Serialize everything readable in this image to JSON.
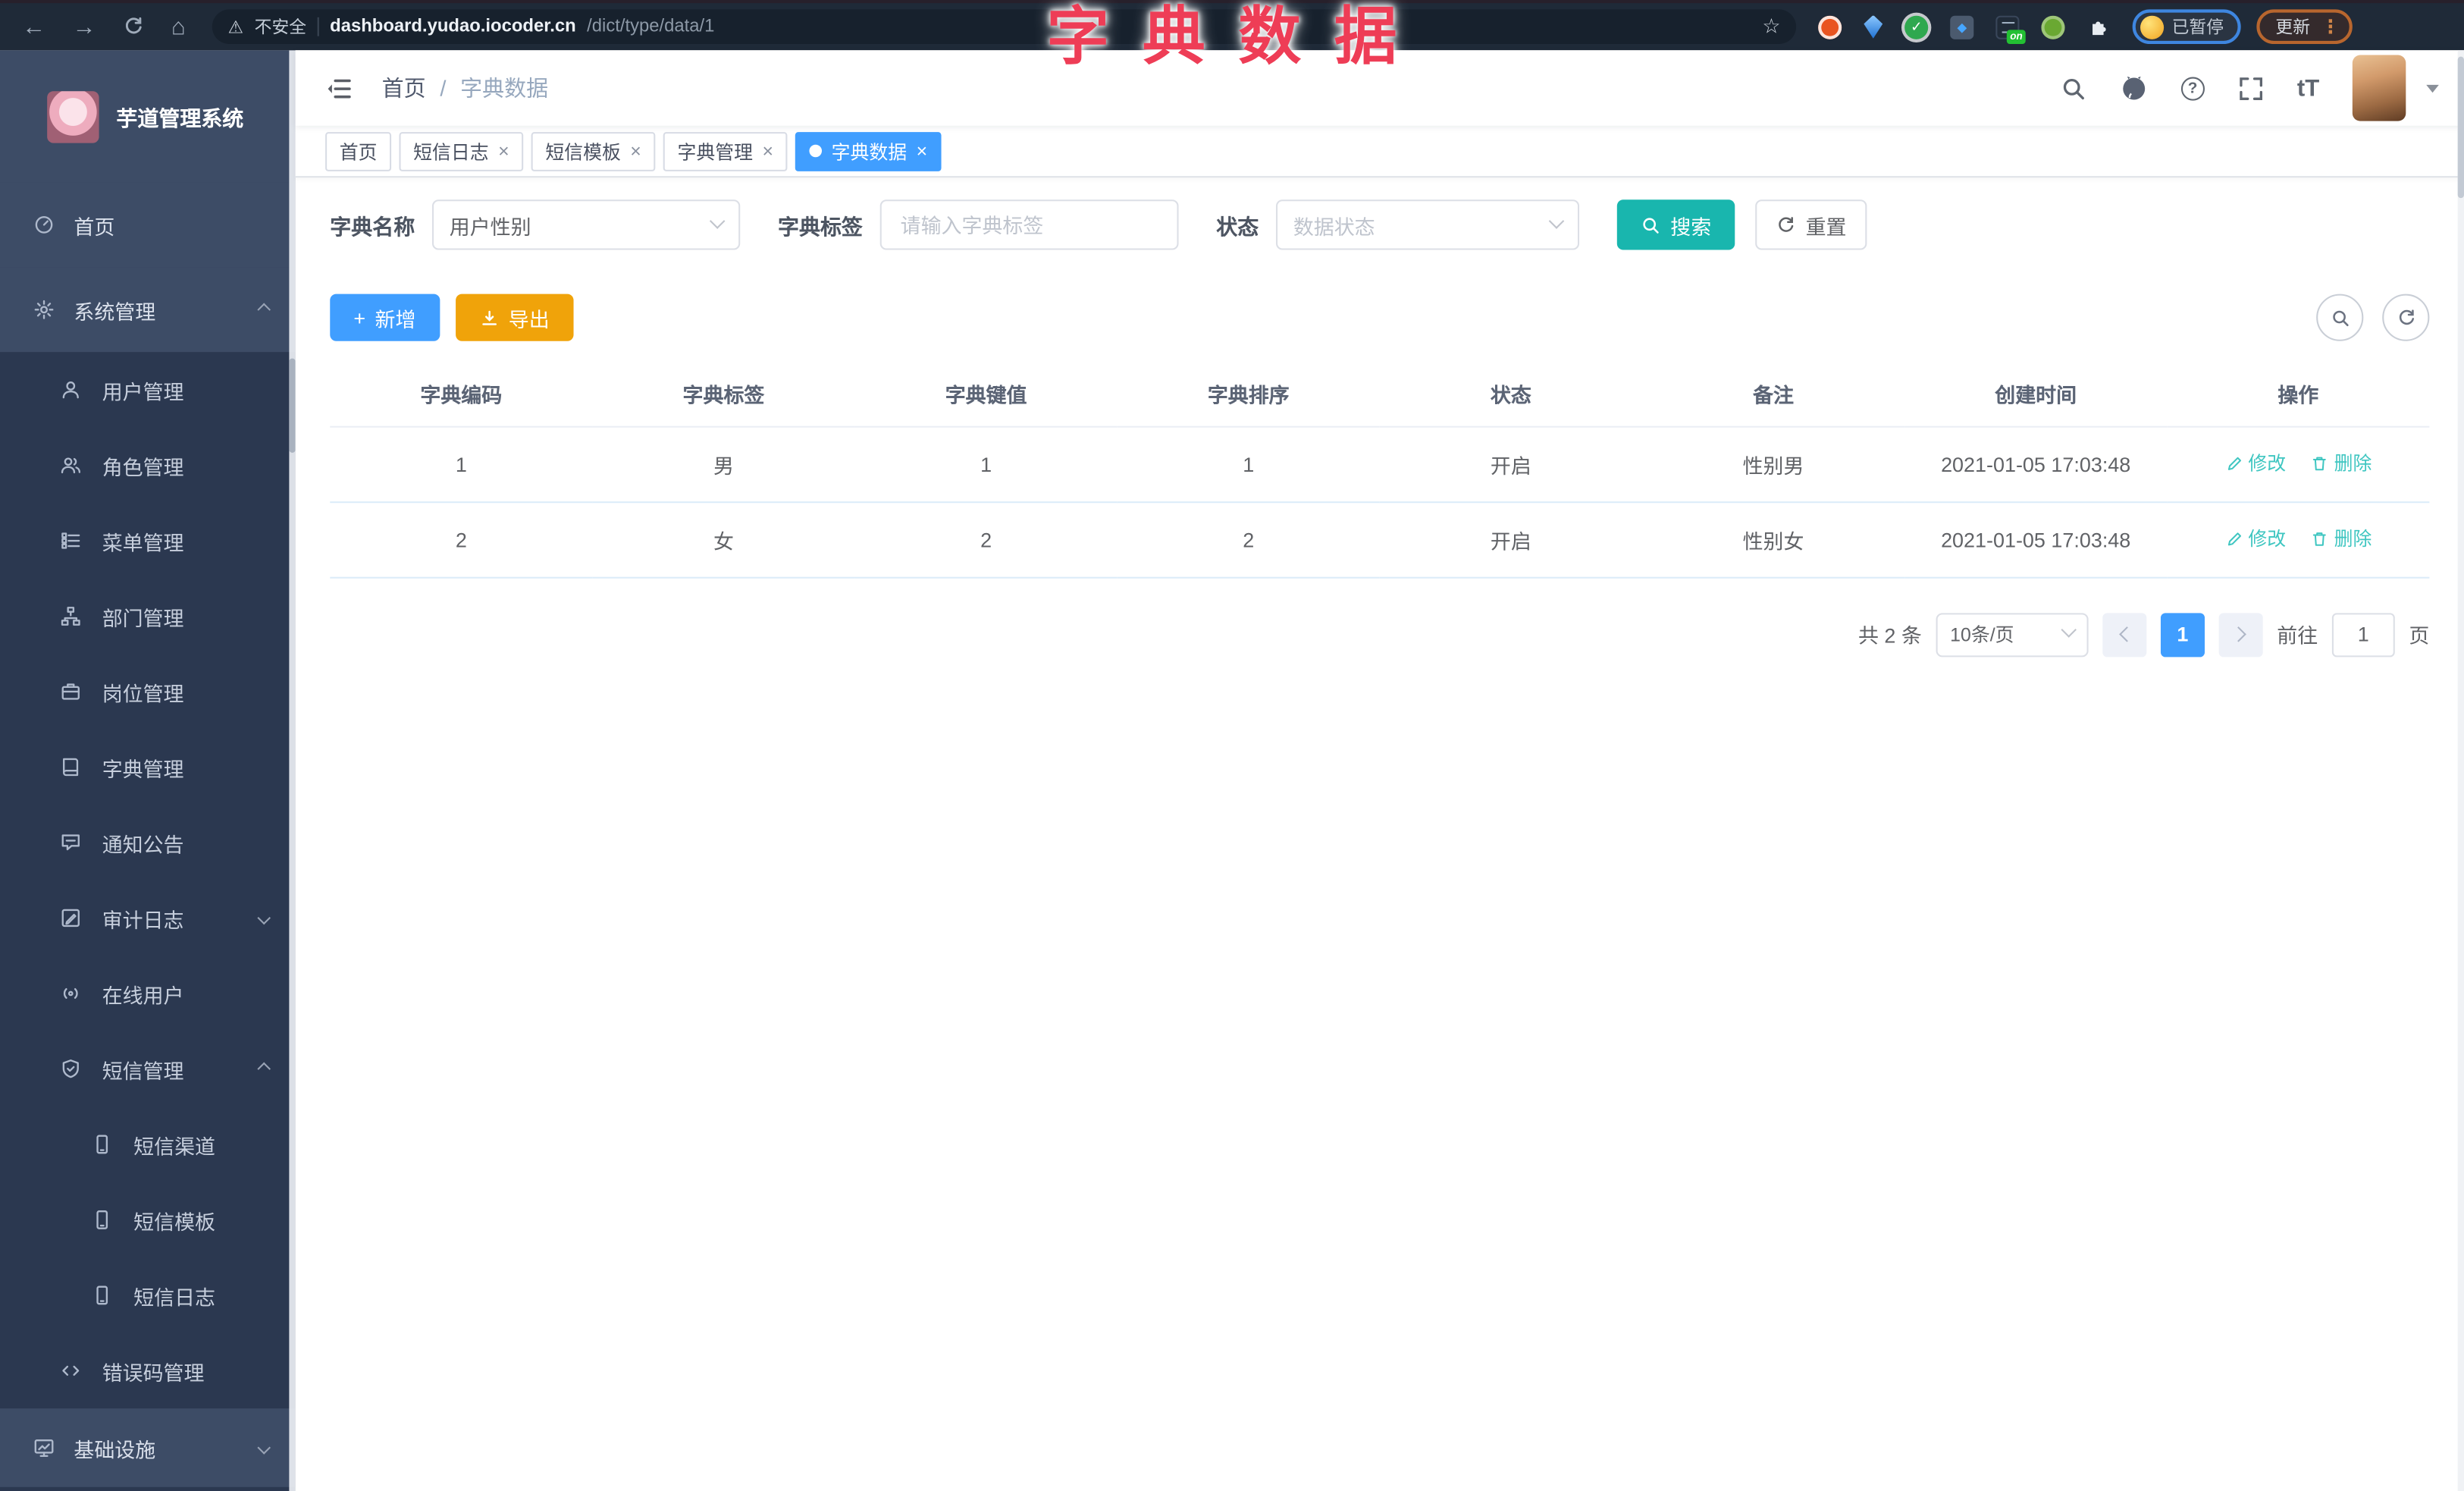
{
  "annotation": {
    "text": "字典数据"
  },
  "icons": {
    "back": "←",
    "forward": "→",
    "home": "⌂",
    "warning": "⚠",
    "star": "☆",
    "kebab": "⋮",
    "help": "?",
    "close": "×",
    "plus": "+",
    "check": "✓",
    "diamond": "◆",
    "font_size": "tT"
  },
  "browser": {
    "security": "不安全",
    "host": "dashboard.yudao.iocoder.cn",
    "path": "/dict/type/data/1",
    "extension_badge": "on",
    "profile_status": "已暂停",
    "update_label": "更新"
  },
  "sidebar": {
    "title": "芋道管理系统",
    "home": "首页",
    "system": "系统管理",
    "user": "用户管理",
    "role": "角色管理",
    "menu": "菜单管理",
    "dept": "部门管理",
    "post": "岗位管理",
    "dict": "字典管理",
    "notice": "通知公告",
    "audit": "审计日志",
    "online": "在线用户",
    "sms": "短信管理",
    "sms_channel": "短信渠道",
    "sms_template": "短信模板",
    "sms_log": "短信日志",
    "errcode": "错误码管理",
    "infra": "基础设施"
  },
  "header": {
    "breadcrumb_home": "首页",
    "breadcrumb_sep": "/",
    "breadcrumb_current": "字典数据"
  },
  "tabs": {
    "home": "首页",
    "sms_log": "短信日志",
    "sms_template": "短信模板",
    "dict_manage": "字典管理",
    "active": "字典数据"
  },
  "filters": {
    "name_label": "字典名称",
    "name_value": "用户性别",
    "label_label": "字典标签",
    "label_placeholder": "请输入字典标签",
    "status_label": "状态",
    "status_placeholder": "数据状态",
    "search_label": "搜索",
    "reset_label": "重置"
  },
  "toolbar": {
    "add_label": "新增",
    "export_label": "导出"
  },
  "table": {
    "headers": [
      "字典编码",
      "字典标签",
      "字典键值",
      "字典排序",
      "状态",
      "备注",
      "创建时间",
      "操作"
    ],
    "rows": [
      [
        "1",
        "男",
        "1",
        "1",
        "开启",
        "性别男",
        "2021-01-05 17:03:48"
      ],
      [
        "2",
        "女",
        "2",
        "2",
        "开启",
        "性别女",
        "2021-01-05 17:03:48"
      ]
    ],
    "edit_label": "修改",
    "delete_label": "删除"
  },
  "pagination": {
    "total": "共 2 条",
    "page_size": "10条/页",
    "page": "1",
    "goto_label": "前往",
    "goto_value": "1",
    "unit_label": "页"
  },
  "colors": {
    "primary": "#409EFF",
    "teal": "#19B6AE",
    "warning": "#F0A30A",
    "link_teal": "#3FC6C1",
    "annotation_red": "#EE3D56",
    "sidebar_bg": "#3D4C66",
    "submenu_bg": "#2B3850"
  }
}
